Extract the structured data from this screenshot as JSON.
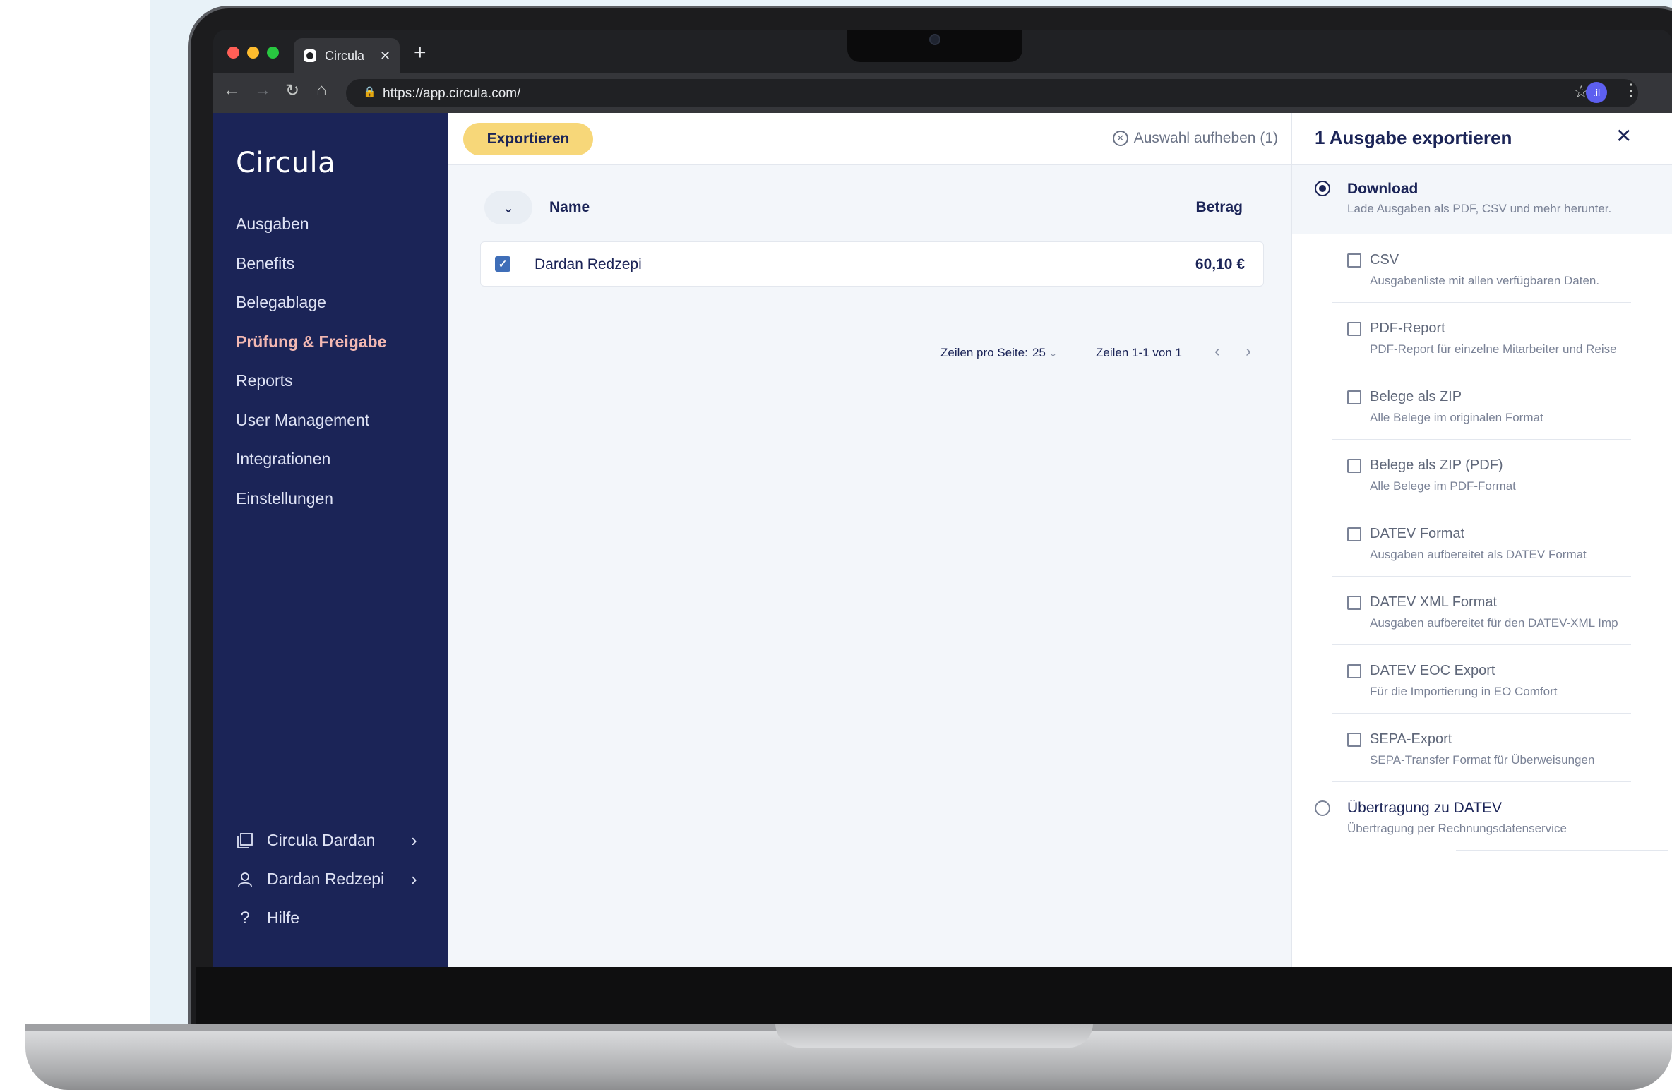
{
  "browser": {
    "tab_title": "Circula",
    "url": "https://app.circula.com/",
    "profile_badge": ".il"
  },
  "sidebar": {
    "brand": "Circula",
    "items": [
      {
        "label": "Ausgaben"
      },
      {
        "label": "Benefits"
      },
      {
        "label": "Belegablage"
      },
      {
        "label": "Prüfung & Freigabe",
        "active": true
      },
      {
        "label": "Reports"
      },
      {
        "label": "User Management"
      },
      {
        "label": "Integrationen"
      },
      {
        "label": "Einstellungen"
      }
    ],
    "bottom": {
      "company": "Circula Dardan",
      "user": "Dardan Redzepi",
      "help": "Hilfe"
    }
  },
  "main": {
    "export_button": "Exportieren",
    "clear_selection": "Auswahl aufheben (1)",
    "table": {
      "col_name": "Name",
      "col_amount": "Betrag",
      "rows": [
        {
          "name": "Dardan Redzepi",
          "amount": "60,10 €",
          "checked": true
        }
      ]
    },
    "pagination": {
      "rows_per_page_label": "Zeilen pro Seite:",
      "rows_per_page_value": "25",
      "range": "Zeilen 1-1 von 1"
    }
  },
  "export_panel": {
    "title": "1 Ausgabe exportieren",
    "download": {
      "title": "Download",
      "subtitle": "Lade Ausgaben als PDF, CSV und mehr herunter.",
      "selected": true
    },
    "options": [
      {
        "title": "CSV",
        "subtitle": "Ausgabenliste mit allen verfügbaren Daten."
      },
      {
        "title": "PDF-Report",
        "subtitle": "PDF-Report für einzelne Mitarbeiter und Reise"
      },
      {
        "title": "Belege als ZIP",
        "subtitle": "Alle Belege im originalen Format"
      },
      {
        "title": "Belege als ZIP (PDF)",
        "subtitle": "Alle Belege im PDF-Format"
      },
      {
        "title": "DATEV Format",
        "subtitle": "Ausgaben aufbereitet als DATEV Format"
      },
      {
        "title": "DATEV XML Format",
        "subtitle": "Ausgaben aufbereitet für den DATEV-XML Imp"
      },
      {
        "title": "DATEV EOC Export",
        "subtitle": "Für die Importierung in EO Comfort"
      },
      {
        "title": "SEPA-Export",
        "subtitle": "SEPA-Transfer Format für Überweisungen"
      }
    ],
    "datev_transfer": {
      "title": "Übertragung zu DATEV",
      "subtitle": "Übertragung per Rechnungsdatenservice",
      "selected": false
    }
  },
  "colors": {
    "sidebar_bg": "#1b2457",
    "accent_yellow": "#f7d779",
    "active_nav": "#f3b8b2",
    "checkbox_blue": "#3f6eb8"
  }
}
